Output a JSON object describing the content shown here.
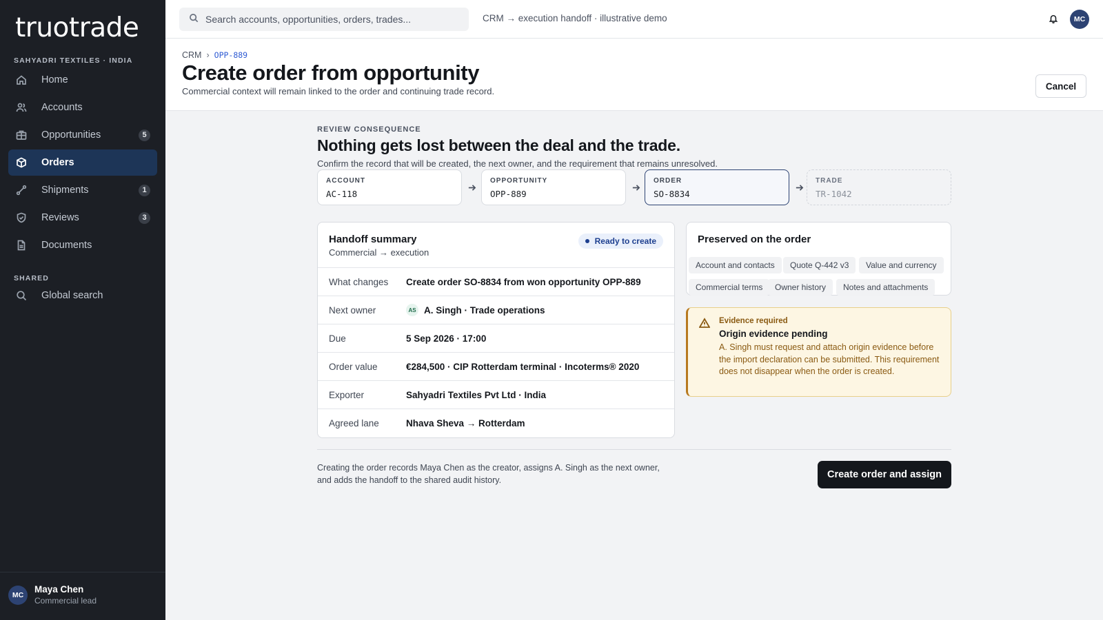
{
  "brand": {
    "logo": "truotrade",
    "org": "SAHYADRI TEXTILES · INDIA"
  },
  "sidebar": {
    "items": [
      {
        "label": "Home",
        "badge": ""
      },
      {
        "label": "Accounts",
        "badge": ""
      },
      {
        "label": "Opportunities",
        "badge": "5"
      },
      {
        "label": "Orders",
        "badge": ""
      },
      {
        "label": "Shipments",
        "badge": "1"
      },
      {
        "label": "Reviews",
        "badge": "3"
      },
      {
        "label": "Documents",
        "badge": ""
      }
    ],
    "shared_heading": "SHARED",
    "shared_items": [
      {
        "label": "Global search"
      }
    ],
    "active": "Orders"
  },
  "user": {
    "initials": "MC",
    "name": "Maya Chen",
    "role": "Commercial lead"
  },
  "topbar": {
    "search_placeholder": "Search accounts, opportunities, orders, trades...",
    "context": "CRM → execution handoff · illustrative demo"
  },
  "header": {
    "breadcrumb": {
      "root": "CRM",
      "current": "OPP-889"
    },
    "title": "Create order from opportunity",
    "subtitle": "Commercial context will remain linked to the order and continuing trade record.",
    "cancel_label": "Cancel"
  },
  "review": {
    "eyebrow": "REVIEW CONSEQUENCE",
    "title": "Nothing gets lost between the deal and the trade.",
    "subtitle": "Confirm the record that will be created, the next owner, and the requirement that remains unresolved."
  },
  "steps": [
    {
      "key": "ACCOUNT",
      "value": "AC-118",
      "state": "done"
    },
    {
      "key": "OPPORTUNITY",
      "value": "OPP-889",
      "state": "done"
    },
    {
      "key": "ORDER",
      "value": "SO-8834",
      "state": "current"
    },
    {
      "key": "TRADE",
      "value": "TR-1042",
      "state": "future"
    }
  ],
  "summary": {
    "title": "Handoff summary",
    "subtitle": "Commercial → execution",
    "status": "Ready to create",
    "rows": [
      {
        "label": "What changes",
        "value": "Create order SO-8834 from won opportunity OPP-889"
      },
      {
        "label": "Next owner",
        "value": "A. Singh · Trade operations",
        "avatar": "AS"
      },
      {
        "label": "Due",
        "value": "5 Sep 2026 · 17:00"
      },
      {
        "label": "Order value",
        "value": "€284,500 · CIP Rotterdam terminal · Incoterms® 2020"
      },
      {
        "label": "Exporter",
        "value": "Sahyadri Textiles Pvt Ltd · India"
      },
      {
        "label": "Agreed lane",
        "value": "Nhava Sheva → Rotterdam"
      }
    ]
  },
  "preserved": {
    "title": "Preserved on the order",
    "chips": [
      "Account and contacts",
      "Quote Q-442 v3",
      "Value and currency",
      "Commercial terms",
      "Owner history",
      "Notes and attachments"
    ]
  },
  "evidence": {
    "kicker": "Evidence required",
    "title": "Origin evidence pending",
    "body": "A. Singh must request and attach origin evidence before the import declaration can be submitted. This requirement does not disappear when the order is created."
  },
  "footer": {
    "note": "Creating the order records Maya Chen as the creator, assigns A. Singh as the next owner, and adds the handoff to the shared audit history.",
    "primary_label": "Create order and assign"
  }
}
